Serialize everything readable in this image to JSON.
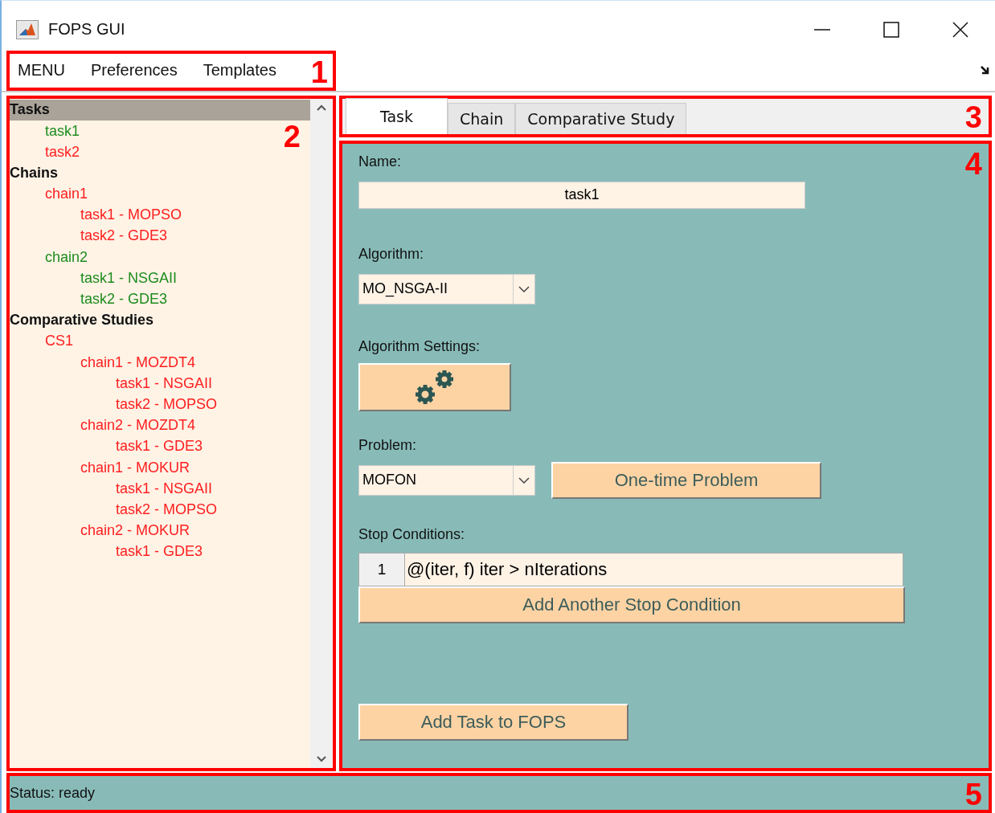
{
  "window": {
    "title": "FOPS GUI"
  },
  "menu_bar": {
    "annotation": "1",
    "items": [
      "MENU",
      "Preferences",
      "Templates"
    ]
  },
  "tree": {
    "annotation": "2",
    "items": [
      {
        "label": "Tasks",
        "selected": true,
        "children": [
          {
            "label": "task1",
            "color": "#1e8c1e"
          },
          {
            "label": "task2",
            "color": "#ff2020"
          }
        ]
      },
      {
        "label": "Chains",
        "selected": false,
        "children": [
          {
            "label": "chain1",
            "color": "#ff2020",
            "children": [
              {
                "label": "task1 - MOPSO",
                "color": "#ff2020"
              },
              {
                "label": "task2 - GDE3",
                "color": "#ff2020"
              }
            ]
          },
          {
            "label": "chain2",
            "color": "#1e8c1e",
            "children": [
              {
                "label": "task1 - NSGAII",
                "color": "#1e8c1e"
              },
              {
                "label": "task2 - GDE3",
                "color": "#1e8c1e"
              }
            ]
          }
        ]
      },
      {
        "label": "Comparative Studies",
        "selected": false,
        "children": [
          {
            "label": "CS1",
            "color": "#ff2020",
            "children": [
              {
                "label": "chain1 - MOZDT4",
                "color": "#ff2020",
                "children": [
                  {
                    "label": "task1 - NSGAII",
                    "color": "#ff2020"
                  },
                  {
                    "label": "task2 - MOPSO",
                    "color": "#ff2020"
                  }
                ]
              },
              {
                "label": "chain2 - MOZDT4",
                "color": "#ff2020",
                "children": [
                  {
                    "label": "task1 - GDE3",
                    "color": "#ff2020"
                  }
                ]
              },
              {
                "label": "chain1 - MOKUR",
                "color": "#ff2020",
                "children": [
                  {
                    "label": "task1 - NSGAII",
                    "color": "#ff2020"
                  },
                  {
                    "label": "task2 - MOPSO",
                    "color": "#ff2020"
                  }
                ]
              },
              {
                "label": "chain2 - MOKUR",
                "color": "#ff2020",
                "children": [
                  {
                    "label": "task1 - GDE3",
                    "color": "#ff2020"
                  }
                ]
              }
            ]
          }
        ]
      }
    ]
  },
  "tabs": {
    "annotation": "3",
    "items": [
      {
        "label": "Task",
        "selected": true
      },
      {
        "label": "Chain",
        "selected": false
      },
      {
        "label": "Comparative Study",
        "selected": false
      }
    ]
  },
  "task_panel": {
    "annotation": "4",
    "name_label": "Name:",
    "name_value": "task1",
    "algorithm_label": "Algorithm:",
    "algorithm_value": "MO_NSGA-II",
    "settings_label": "Algorithm Settings:",
    "problem_label": "Problem:",
    "problem_value": "MOFON",
    "one_time_button": "One-time Problem",
    "stop_label": "Stop Conditions:",
    "stop_conditions": [
      {
        "index": "1",
        "expression": "@(iter, f) iter > nIterations"
      }
    ],
    "add_stop_button": "Add Another Stop Condition",
    "add_task_button": "Add Task to FOPS"
  },
  "status_bar": {
    "annotation": "5",
    "text": "Status: ready"
  }
}
